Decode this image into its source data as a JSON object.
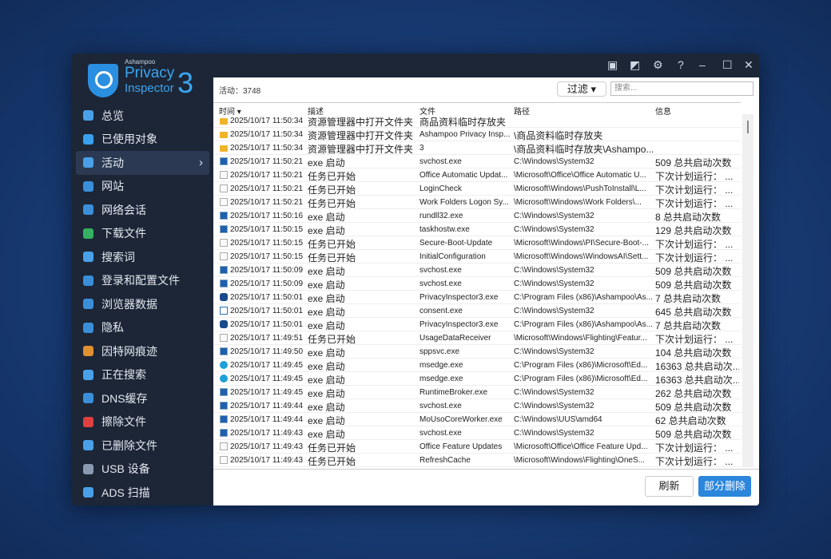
{
  "app": {
    "brand": "Ashampoo",
    "name1": "Privacy",
    "name2": "Inspector",
    "version": "3"
  },
  "titlebar": {
    "icons": [
      "feedback-icon",
      "news-icon",
      "settings-icon",
      "help-icon",
      "minimize-icon",
      "maximize-icon",
      "close-icon"
    ],
    "glyphs": [
      "▣",
      "◩",
      "⚙",
      "?",
      "–",
      "☐",
      "✕"
    ]
  },
  "sidebar": {
    "items": [
      {
        "label": "总览",
        "color": "#4aa0e8"
      },
      {
        "label": "已使用对象",
        "color": "#3aa0f0"
      },
      {
        "label": "活动",
        "color": "#4aa0e8",
        "active": true
      },
      {
        "label": "网站",
        "color": "#3a8fd8"
      },
      {
        "label": "网络会话",
        "color": "#3a8fd8"
      },
      {
        "label": "下载文件",
        "color": "#35b060"
      },
      {
        "label": "搜索词",
        "color": "#4aa0e8"
      },
      {
        "label": "登录和配置文件",
        "color": "#3a8fd8"
      },
      {
        "label": "浏览器数据",
        "color": "#3a8fd8"
      },
      {
        "label": "隐私",
        "color": "#3a8fd8"
      },
      {
        "label": "因特网痕迹",
        "color": "#e09030"
      },
      {
        "label": "正在搜索",
        "color": "#4aa0e8"
      },
      {
        "label": "DNS缓存",
        "color": "#3a8fd8"
      },
      {
        "label": "擦除文件",
        "color": "#e04040"
      },
      {
        "label": "已删除文件",
        "color": "#4aa0e8"
      },
      {
        "label": "USB 设备",
        "color": "#8a9ab0"
      },
      {
        "label": "ADS 扫描",
        "color": "#4aa0e8"
      }
    ]
  },
  "toolbar": {
    "count_label": "活动：3748",
    "filter_label": "过滤 ▾",
    "search_placeholder": "搜索..."
  },
  "table": {
    "headers": [
      "时间 ▾",
      "描述",
      "文件",
      "路径",
      "信息"
    ],
    "rows": [
      [
        "folder",
        "2025/10/17 11:50:34",
        "资源管理器中打开文件夹",
        "商品资料临时存放夹",
        "",
        ""
      ],
      [
        "folder",
        "2025/10/17 11:50:34",
        "资源管理器中打开文件夹",
        "Ashampoo Privacy Insp...",
        "\\商品资料临时存放夹",
        ""
      ],
      [
        "folder",
        "2025/10/17 11:50:34",
        "资源管理器中打开文件夹",
        "3",
        "\\商品资料临时存放夹\\Ashampo...",
        ""
      ],
      [
        "exe",
        "2025/10/17 11:50:21",
        "exe 启动",
        "svchost.exe",
        "C:\\Windows\\System32",
        "509 总共启动次数"
      ],
      [
        "task",
        "2025/10/17 11:50:21",
        "任务已开始",
        "Office Automatic Updat...",
        "\\Microsoft\\Office\\Office Automatic U...",
        "下次计划运行： ..."
      ],
      [
        "task",
        "2025/10/17 11:50:21",
        "任务已开始",
        "LoginCheck",
        "\\Microsoft\\Windows\\PushToInstall\\L...",
        "下次计划运行： ..."
      ],
      [
        "task",
        "2025/10/17 11:50:21",
        "任务已开始",
        "Work Folders Logon Sy...",
        "\\Microsoft\\Windows\\Work Folders\\...",
        "下次计划运行： ..."
      ],
      [
        "exe",
        "2025/10/17 11:50:16",
        "exe 启动",
        "rundll32.exe",
        "C:\\Windows\\System32",
        "8 总共启动次数"
      ],
      [
        "exe",
        "2025/10/17 11:50:15",
        "exe 启动",
        "taskhostw.exe",
        "C:\\Windows\\System32",
        "129 总共启动次数"
      ],
      [
        "task",
        "2025/10/17 11:50:15",
        "任务已开始",
        "Secure-Boot-Update",
        "\\Microsoft\\Windows\\PI\\Secure-Boot-...",
        "下次计划运行： ..."
      ],
      [
        "task",
        "2025/10/17 11:50:15",
        "任务已开始",
        "InitialConfiguration",
        "\\Microsoft\\Windows\\WindowsAI\\Sett...",
        "下次计划运行： ..."
      ],
      [
        "exe",
        "2025/10/17 11:50:09",
        "exe 启动",
        "svchost.exe",
        "C:\\Windows\\System32",
        "509 总共启动次数"
      ],
      [
        "exe",
        "2025/10/17 11:50:09",
        "exe 启动",
        "svchost.exe",
        "C:\\Windows\\System32",
        "509 总共启动次数"
      ],
      [
        "pi",
        "2025/10/17 11:50:01",
        "exe 启动",
        "PrivacyInspector3.exe",
        "C:\\Program Files (x86)\\Ashampoo\\As...",
        "7 总共启动次数"
      ],
      [
        "window",
        "2025/10/17 11:50:01",
        "exe 启动",
        "consent.exe",
        "C:\\Windows\\System32",
        "645 总共启动次数"
      ],
      [
        "pi",
        "2025/10/17 11:50:01",
        "exe 启动",
        "PrivacyInspector3.exe",
        "C:\\Program Files (x86)\\Ashampoo\\As...",
        "7 总共启动次数"
      ],
      [
        "task",
        "2025/10/17 11:49:51",
        "任务已开始",
        "UsageDataReceiver",
        "\\Microsoft\\Windows\\Flighting\\Featur...",
        "下次计划运行： ..."
      ],
      [
        "exe",
        "2025/10/17 11:49:50",
        "exe 启动",
        "sppsvc.exe",
        "C:\\Windows\\System32",
        "104 总共启动次数"
      ],
      [
        "edge",
        "2025/10/17 11:49:45",
        "exe 启动",
        "msedge.exe",
        "C:\\Program Files (x86)\\Microsoft\\Ed...",
        "16363 总共启动次..."
      ],
      [
        "edge",
        "2025/10/17 11:49:45",
        "exe 启动",
        "msedge.exe",
        "C:\\Program Files (x86)\\Microsoft\\Ed...",
        "16363 总共启动次..."
      ],
      [
        "exe",
        "2025/10/17 11:49:45",
        "exe 启动",
        "RuntimeBroker.exe",
        "C:\\Windows\\System32",
        "262 总共启动次数"
      ],
      [
        "exe",
        "2025/10/17 11:49:44",
        "exe 启动",
        "svchost.exe",
        "C:\\Windows\\System32",
        "509 总共启动次数"
      ],
      [
        "exe",
        "2025/10/17 11:49:44",
        "exe 启动",
        "MoUsoCoreWorker.exe",
        "C:\\Windows\\UUS\\amd64",
        "62 总共启动次数"
      ],
      [
        "exe",
        "2025/10/17 11:49:43",
        "exe 启动",
        "svchost.exe",
        "C:\\Windows\\System32",
        "509 总共启动次数"
      ],
      [
        "task",
        "2025/10/17 11:49:43",
        "任务已开始",
        "Office Feature Updates",
        "\\Microsoft\\Office\\Office Feature Upd...",
        "下次计划运行： ..."
      ],
      [
        "task",
        "2025/10/17 11:49:43",
        "任务已开始",
        "RefreshCache",
        "\\Microsoft\\Windows\\Flighting\\OneS...",
        "下次计划运行： ..."
      ]
    ]
  },
  "footer": {
    "refresh_label": "刷新",
    "delete_label": "部分删除"
  }
}
